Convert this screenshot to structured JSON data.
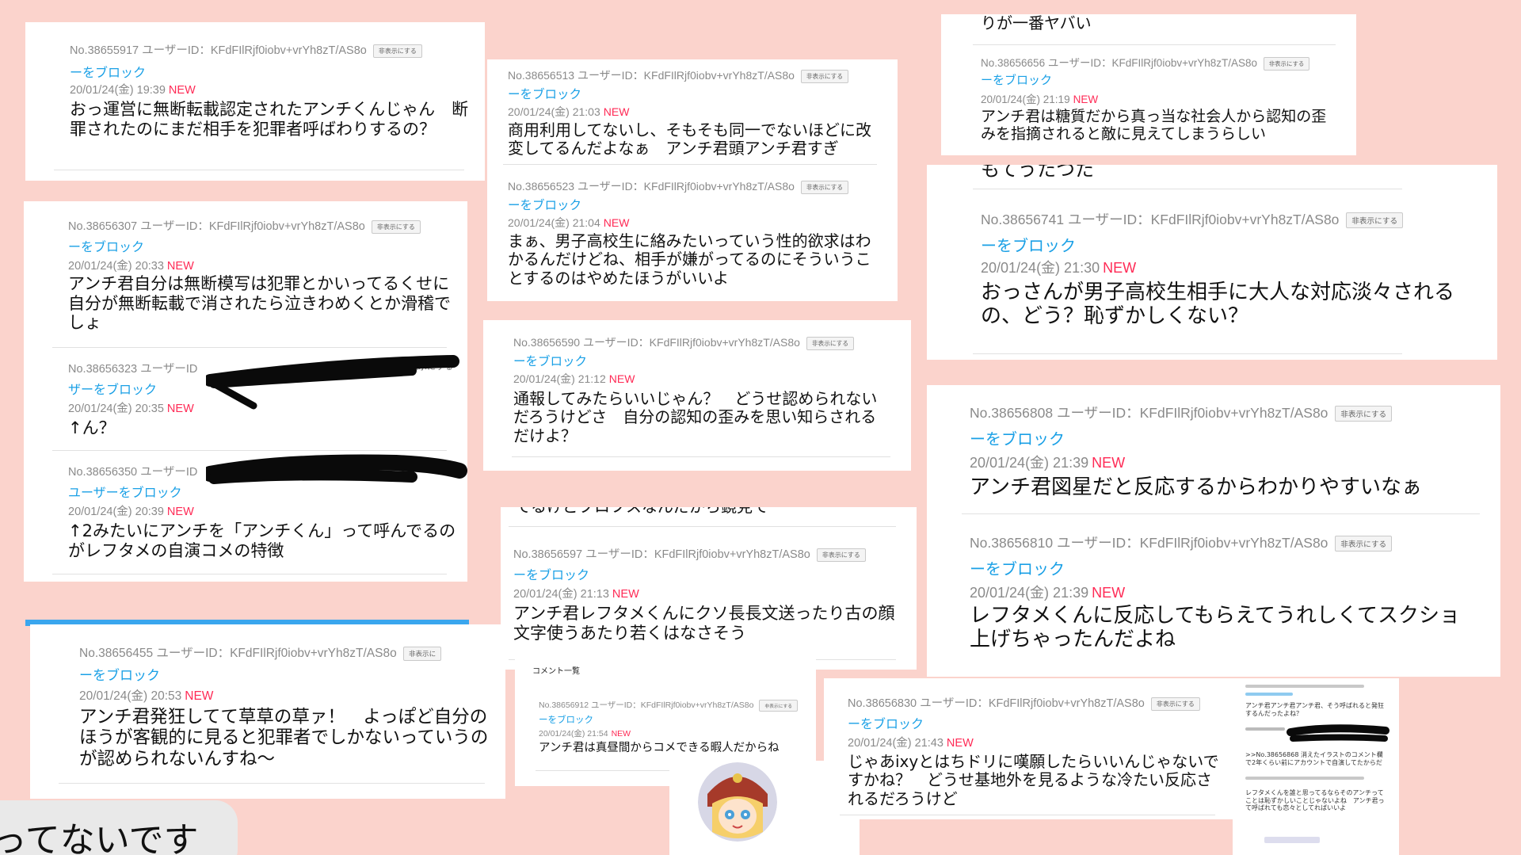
{
  "labels": {
    "hide": "非表示にする",
    "block": "ーをブロック",
    "block_user": "ユーザーをブロック",
    "block_user2": "ザーをブロック",
    "new": "NEW",
    "comment_list": "コメント一覧"
  },
  "card_a": {
    "meta": "No.38655917 ユーザーID：KFdFIlRjf0iobv+vrYh8zT/AS8o",
    "date": "20/01/24(金) 19:39",
    "body": "おっ運営に無断転載認定されたアンチくんじゃん　断罪されたのにまだ相手を犯罪者呼ばわりするの？"
  },
  "card_b": {
    "posts": [
      {
        "meta": "No.38656307 ユーザーID：KFdFIlRjf0iobv+vrYh8zT/AS8o",
        "date": "20/01/24(金) 20:33",
        "body": "アンチ君自分は無断模写は犯罪とかいってるくせに自分が無断転載で消されたら泣きわめくとか滑稽でしょ"
      },
      {
        "meta": "No.38656323 ユーザーID",
        "date": "20/01/24(金) 20:35",
        "body": "↑ん？"
      },
      {
        "meta": "No.38656350 ユーザーID",
        "date": "20/01/24(金) 20:39",
        "body": "↑2みたいにアンチを「アンチくん」って呼んでるのがレフタメの自演コメの特徴"
      }
    ]
  },
  "card_c": {
    "meta": "No.38656455 ユーザーID：KFdFIlRjf0iobv+vrYh8zT/AS8o",
    "hide_partial": "非表示に",
    "date": "20/01/24(金) 20:53",
    "body": "アンチ君発狂してて草草の草ァ！　よっぽど自分のほうが客観的に見ると犯罪者でしかないっていうのが認められないんすね〜"
  },
  "chat": {
    "text": "ってないです"
  },
  "card_d": {
    "posts": [
      {
        "meta": "No.38656513 ユーザーID：KFdFIlRjf0iobv+vrYh8zT/AS8o",
        "date": "20/01/24(金) 21:03",
        "body": "商用利用してないし、そもそも同一でないほどに改変してるんだよなぁ　アンチ君頭アンチ君すぎ"
      },
      {
        "meta": "No.38656523 ユーザーID：KFdFIlRjf0iobv+vrYh8zT/AS8o",
        "date": "20/01/24(金) 21:04",
        "body": "まぁ、男子高校生に絡みたいっていう性的欲求はわかるんだけどね、相手が嫌がってるのにそういうことするのはやめたほうがいいよ"
      }
    ]
  },
  "card_e": {
    "meta": "No.38656590 ユーザーID：KFdFIlRjf0iobv+vrYh8zT/AS8o",
    "date": "20/01/24(金) 21:12",
    "body": "通報してみたらいいじゃん？　どうせ認められないだろうけどさ　自分の認知の歪みを思い知らされるだけよ？"
  },
  "card_f": {
    "top_text": "てるけどブロフスなんだから鏡見て",
    "meta": "No.38656597 ユーザーID：KFdFIlRjf0iobv+vrYh8zT/AS8o",
    "date": "20/01/24(金) 21:13",
    "body": "アンチ君レフタメくんにクソ長長文送ったり古の顔文字使うあたり若くはなさそう"
  },
  "card_g": {
    "meta": "No.38656912 ユーザーID：KFdFIlRjf0iobv+vrYh8zT/AS8o",
    "date": "20/01/24(金) 21:54",
    "body": "アンチ君は真昼間からコメできる暇人だからね"
  },
  "card_h": {
    "top_text": "りが一番ヤバい",
    "meta": "No.38656656 ユーザーID：KFdFIlRjf0iobv+vrYh8zT/AS8o",
    "date": "20/01/24(金) 21:19",
    "body": "アンチ君は糖質だから真っ当な社会人から認知の歪みを指摘されると敵に見えてしまうらしい"
  },
  "card_i": {
    "top_text": "もてうたつた",
    "meta": "No.38656741 ユーザーID：KFdFIlRjf0iobv+vrYh8zT/AS8o",
    "date": "20/01/24(金) 21:30",
    "body": "おっさんが男子高校生相手に大人な対応淡々されるの、どう？恥ずかしくない？"
  },
  "card_j": {
    "posts": [
      {
        "meta": "No.38656808 ユーザーID：KFdFIlRjf0iobv+vrYh8zT/AS8o",
        "date": "20/01/24(金) 21:39",
        "body": "アンチ君図星だと反応するからわかりやすいなぁ"
      },
      {
        "meta": "No.38656810 ユーザーID：KFdFIlRjf0iobv+vrYh8zT/AS8o",
        "date": "20/01/24(金) 21:39",
        "body": "レフタメくんに反応してもらえてうれしくてスクショ上げちゃったんだよね"
      }
    ]
  },
  "card_k": {
    "meta": "No.38656830 ユーザーID：KFdFIlRjf0iobv+vrYh8zT/AS8o",
    "date": "20/01/24(金) 21:43",
    "body": "じゃあixyとはちドリに嘆願したらいいんじゃないですかね？　どうせ基地外を見るような冷たい反応されるだろうけど"
  },
  "card_l": {
    "line1": "アンチ君アンチ君アンチ君、そう呼ばれると発狂するんだったよね？",
    "line2": ">>No.38656868 消えたイラストのコメント欄で2年くらい前にアカウントで自演してたからだ",
    "line3": "レフタメくんを誰と思ってるならそのアンチってことは恥ずかしいことじゃないよね　アンチ君って呼ばれても恋々としてればいいよ"
  }
}
